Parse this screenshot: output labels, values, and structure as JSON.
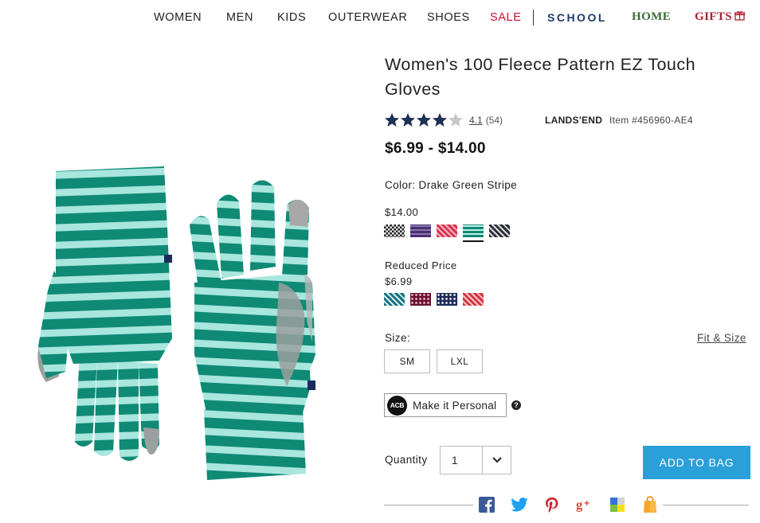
{
  "nav": {
    "items": [
      "WOMEN",
      "MEN",
      "KIDS",
      "OUTERWEAR",
      "SHOES",
      "SALE"
    ],
    "school": "SCHOOL",
    "home": "HOME",
    "gifts": "GIFTS"
  },
  "product": {
    "title": "Women's 100 Fleece Pattern EZ Touch Gloves",
    "rating_value": "4.1",
    "rating_count": "(54)",
    "rating_stars": 4.1,
    "brand": "LANDS'END",
    "item_number": "Item #456960-AE4",
    "price_range": "$6.99 - $14.00",
    "color_label": "Color: Drake Green Stripe",
    "regular_price": "$14.00",
    "reduced_label": "Reduced Price",
    "reduced_price": "$6.99",
    "size_label": "Size:",
    "fit_size_link": "Fit & Size",
    "sizes": [
      "SM",
      "LXL"
    ],
    "personalize_label": "Make it Personal",
    "monogram_text": "ACB",
    "help_glyph": "?",
    "quantity_label": "Quantity",
    "quantity_value": "1",
    "add_to_bag": "ADD TO BAG"
  },
  "swatches": {
    "regular": [
      {
        "name": "black-white-check",
        "colors": [
          "#222222",
          "#e8e8e8"
        ]
      },
      {
        "name": "purple-stripe",
        "colors": [
          "#4a2f6e",
          "#8c74b5"
        ]
      },
      {
        "name": "red-floral",
        "colors": [
          "#d8344f",
          "#f2b5c0"
        ]
      },
      {
        "name": "drake-green-stripe",
        "colors": [
          "#0f8a75",
          "#bfeee4"
        ],
        "selected": true
      },
      {
        "name": "black-white-print",
        "colors": [
          "#2c2c34",
          "#d9d9e0"
        ]
      }
    ],
    "reduced": [
      {
        "name": "teal-geometric",
        "colors": [
          "#17707e",
          "#d6eef0"
        ]
      },
      {
        "name": "burgundy-dot",
        "colors": [
          "#6b1230",
          "#e6b8c6"
        ]
      },
      {
        "name": "navy-dot",
        "colors": [
          "#1d2b58",
          "#e8e8f0"
        ]
      },
      {
        "name": "red-fairisle",
        "colors": [
          "#d1363d",
          "#f6c6c9"
        ]
      }
    ]
  },
  "colors": {
    "accent_blue": "#2b9fd8",
    "sale_red": "#c8102e",
    "star_navy": "#1f2f55",
    "glove_green": "#0f8a75",
    "glove_stripe": "#a9e6de"
  },
  "icons": [
    "gift-icon",
    "star-icon",
    "help-icon",
    "chevron-down-icon",
    "facebook-icon",
    "twitter-icon",
    "pinterest-icon",
    "google-plus-icon",
    "delicious-icon",
    "shopping-bag-icon"
  ]
}
